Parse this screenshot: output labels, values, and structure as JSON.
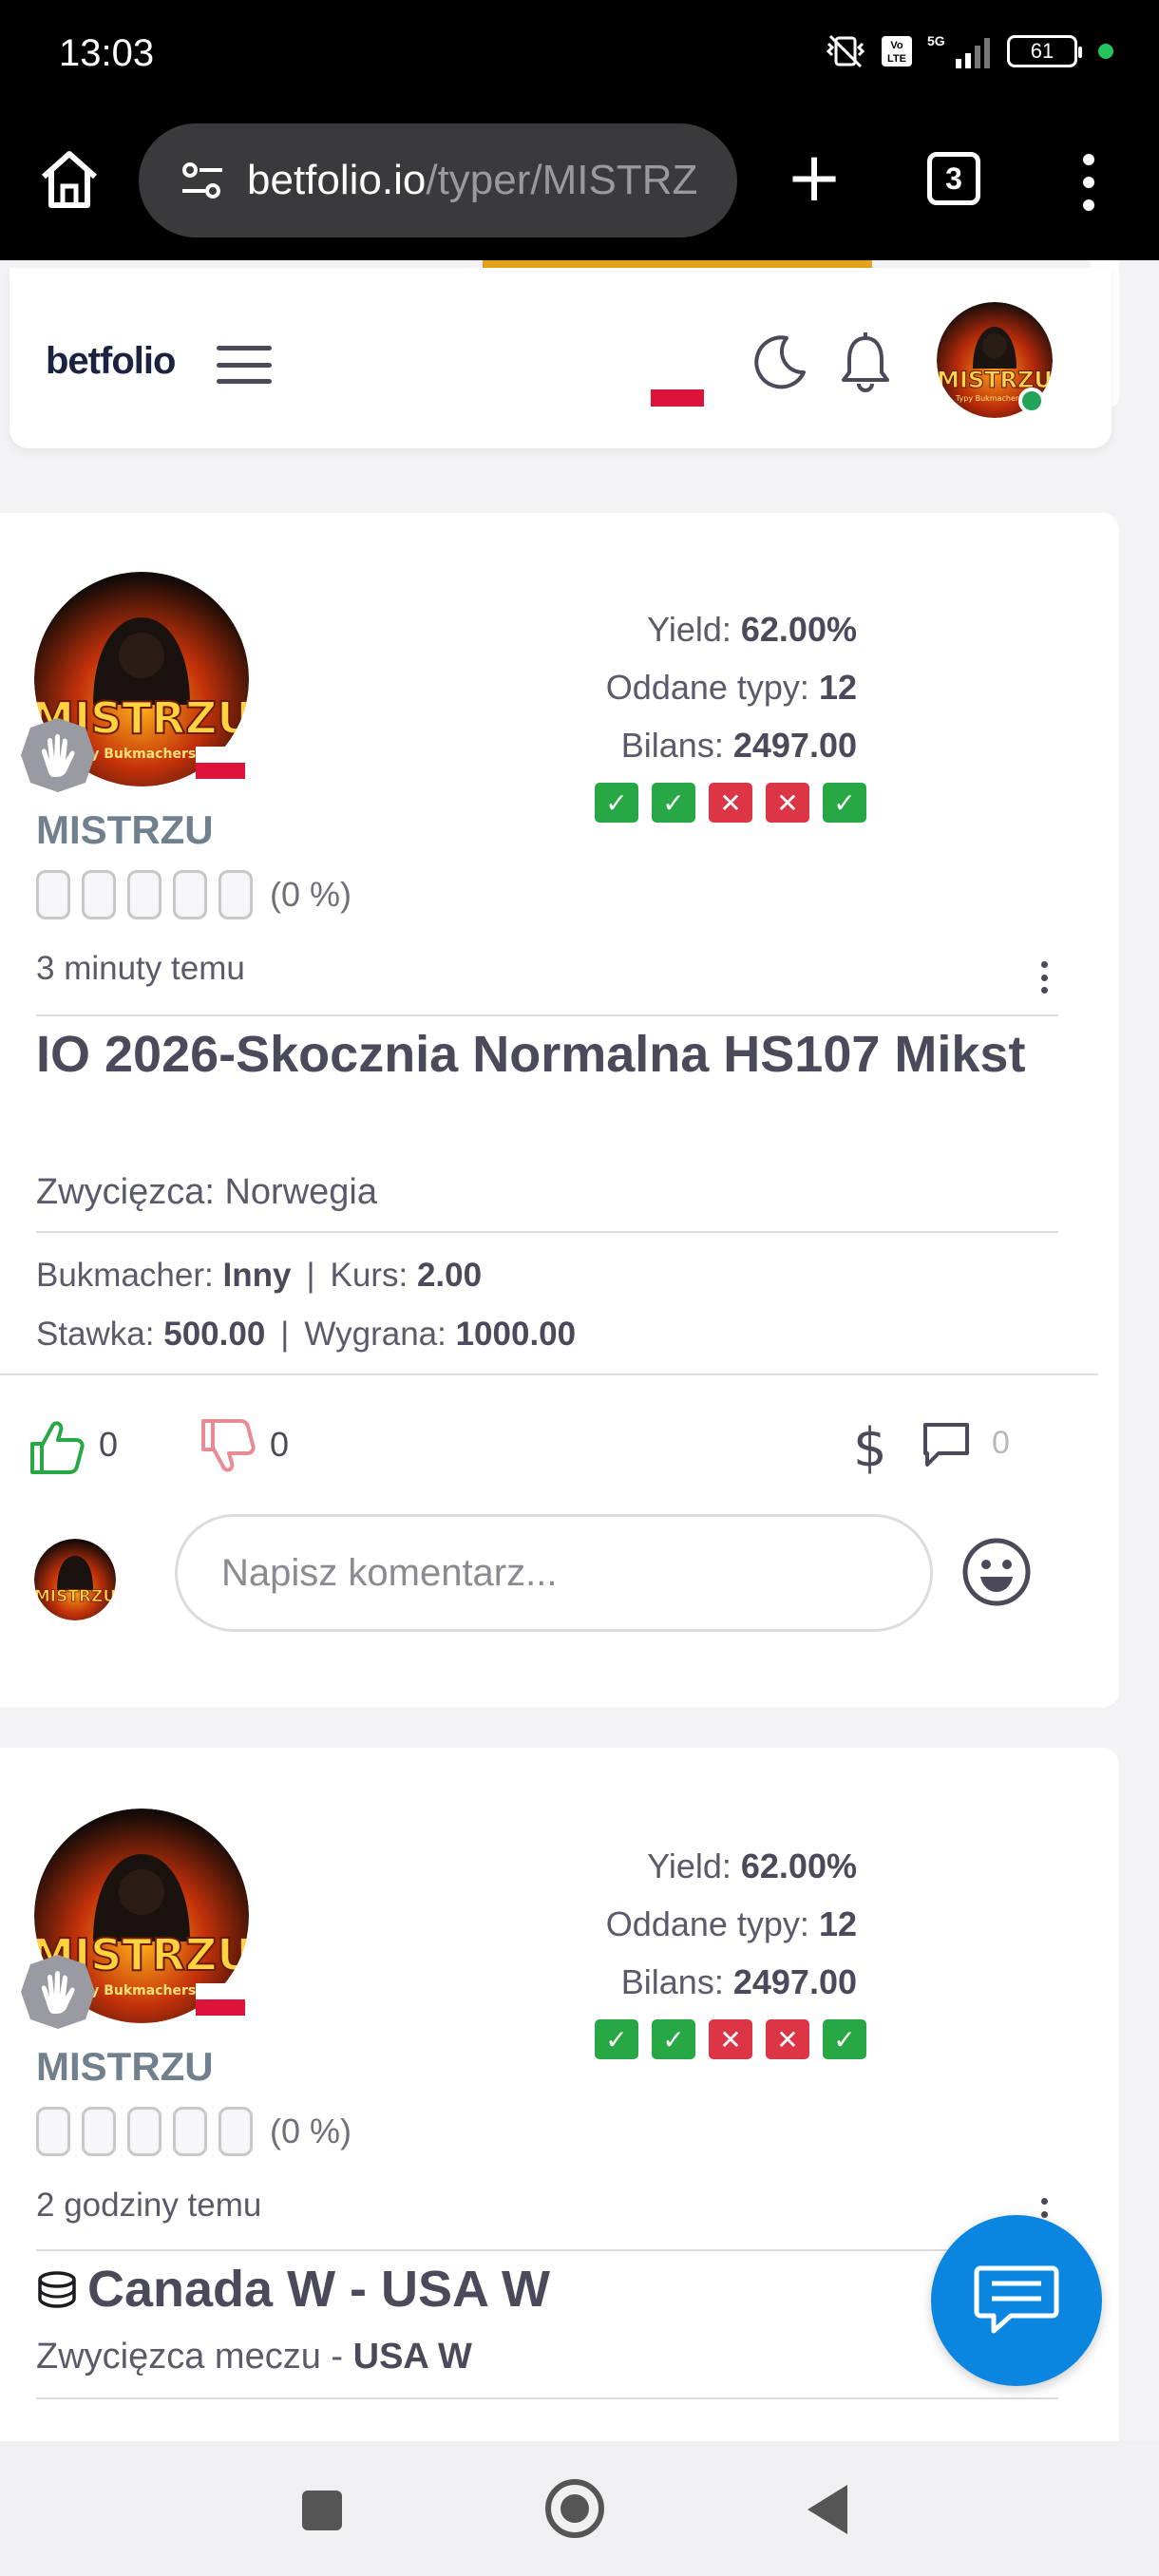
{
  "status_bar": {
    "time": "13:03",
    "network": "5G",
    "volte": "Vo LTE",
    "battery": "61"
  },
  "browser": {
    "url_host": "betfolio.io",
    "url_path": "/typer/MISTRZ",
    "tab_count": "3"
  },
  "header": {
    "logo": "betfolio"
  },
  "posts": [
    {
      "username": "MISTRZU",
      "rating_pct": "(0 %)",
      "stats": {
        "yield_label": "Yield:",
        "yield": "62.00%",
        "tips_label": "Oddane typy:",
        "tips": "12",
        "balance_label": "Bilans:",
        "balance": "2497.00"
      },
      "form": [
        "win",
        "win",
        "loss",
        "loss",
        "win"
      ],
      "time_ago": "3 minuty temu",
      "title": "IO 2026-Skocznia Normalna HS107 Mikst",
      "pick": "Zwycięzca: Norwegia",
      "bookmaker_label": "Bukmacher:",
      "bookmaker": "Inny",
      "odds_label": "Kurs:",
      "odds": "2.00",
      "stake_label": "Stawka:",
      "stake": "500.00",
      "win_label": "Wygrana:",
      "win": "1000.00",
      "likes": "0",
      "dislikes": "0",
      "comments": "0",
      "comment_placeholder": "Napisz komentarz..."
    },
    {
      "username": "MISTRZU",
      "rating_pct": "(0 %)",
      "stats": {
        "yield_label": "Yield:",
        "yield": "62.00%",
        "tips_label": "Oddane typy:",
        "tips": "12",
        "balance_label": "Bilans:",
        "balance": "2497.00"
      },
      "form": [
        "win",
        "win",
        "loss",
        "loss",
        "win"
      ],
      "time_ago": "2 godziny temu",
      "title": "Canada W - USA W",
      "pick_label": "Zwycięzca meczu -",
      "pick_value": "USA W"
    }
  ],
  "colors": {
    "win": "#28a745",
    "loss": "#dc3545",
    "accent": "#0b86e0",
    "tab_indicator": "#e3a21a"
  }
}
